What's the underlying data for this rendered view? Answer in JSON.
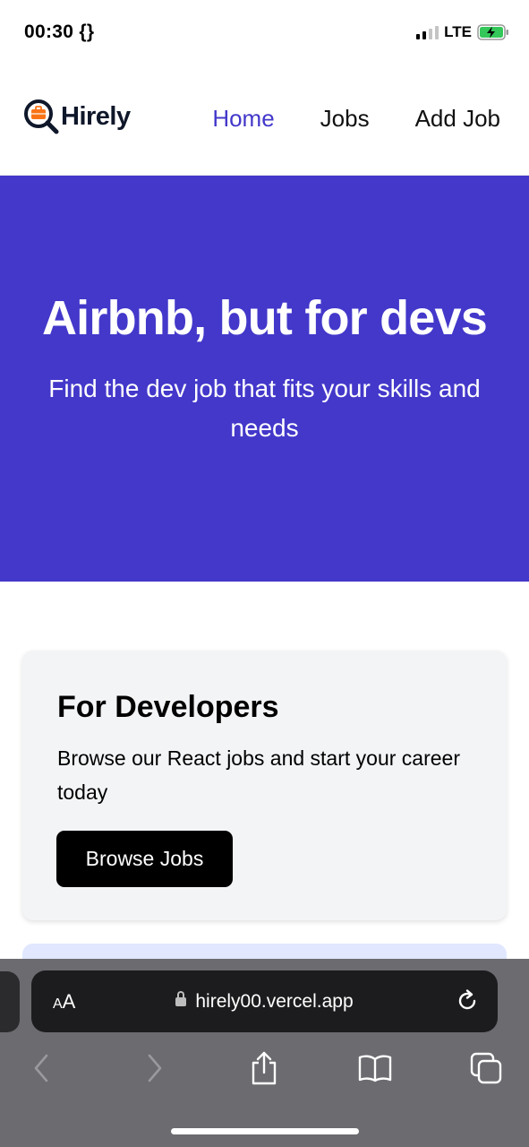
{
  "status_bar": {
    "time": "00:30 {}",
    "network": "LTE"
  },
  "nav": {
    "brand": "Hirely",
    "links": [
      {
        "label": "Home",
        "active": true
      },
      {
        "label": "Jobs",
        "active": false
      },
      {
        "label": "Add Job",
        "active": false
      }
    ]
  },
  "hero": {
    "title": "Airbnb, but for devs",
    "subtitle": "Find the dev job that fits your skills and needs"
  },
  "developers_card": {
    "title": "For Developers",
    "text": "Browse our React jobs and start your career today",
    "button": "Browse Jobs"
  },
  "browser": {
    "aa_label_small": "A",
    "aa_label_large": "A",
    "url": "hirely00.vercel.app"
  },
  "colors": {
    "accent": "#4338ca",
    "hero_bg": "#4338ca",
    "card_bg": "#f3f4f6",
    "button_bg": "#000000"
  }
}
